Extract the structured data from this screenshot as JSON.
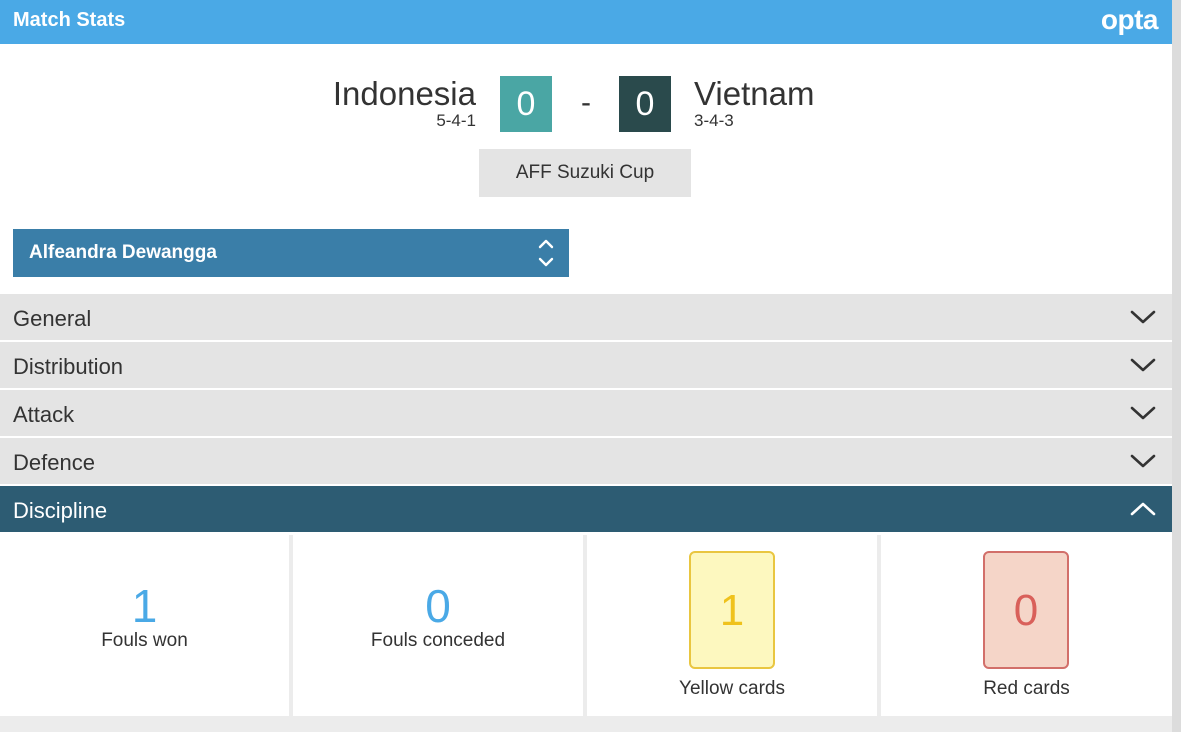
{
  "header": {
    "title": "Match Stats",
    "brand": "opta"
  },
  "match": {
    "home": {
      "name": "Indonesia",
      "formation": "5-4-1",
      "score": "0"
    },
    "away": {
      "name": "Vietnam",
      "formation": "3-4-3",
      "score": "0"
    },
    "separator": "-",
    "competition": "AFF Suzuki Cup"
  },
  "player_select": {
    "selected": "Alfeandra Dewangga"
  },
  "sections": [
    {
      "label": "General",
      "expanded": false
    },
    {
      "label": "Distribution",
      "expanded": false
    },
    {
      "label": "Attack",
      "expanded": false
    },
    {
      "label": "Defence",
      "expanded": false
    },
    {
      "label": "Discipline",
      "expanded": true
    }
  ],
  "discipline": {
    "fouls_won": {
      "value": "1",
      "label": "Fouls won"
    },
    "fouls_conceded": {
      "value": "0",
      "label": "Fouls conceded"
    },
    "yellow_cards": {
      "value": "1",
      "label": "Yellow cards"
    },
    "red_cards": {
      "value": "0",
      "label": "Red cards"
    }
  },
  "colors": {
    "header": "#4aa9e6",
    "home_score": "#4aa6a4",
    "away_score": "#2a4a4c",
    "player_select": "#3a7ea8",
    "active_section": "#2d5c73",
    "stat_value": "#4aa9e6",
    "yellow_card": "#fdf8bf",
    "red_card": "#f5d5c8"
  }
}
